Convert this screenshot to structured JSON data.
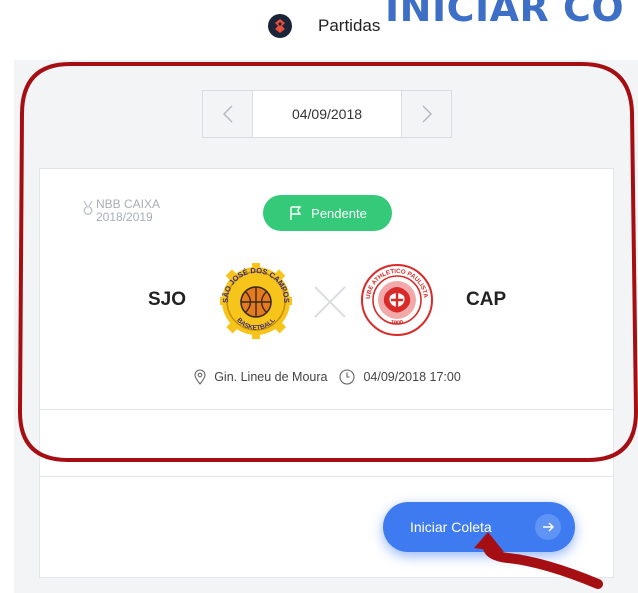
{
  "slide": {
    "title_fragment": "INICIAR CO"
  },
  "header": {
    "logo_icon": "app-logo-icon",
    "title": "Partidas"
  },
  "date_nav": {
    "prev_icon": "chevron-left-icon",
    "value": "04/09/2018",
    "next_icon": "chevron-right-icon"
  },
  "match": {
    "league_icon": "medal-icon",
    "league_line1": "NBB CAIXA",
    "league_line2": "2018/2019",
    "status_icon": "flag-icon",
    "status": "Pendente",
    "home_code": "SJO",
    "home_logo_text": "SÃO JOSÉ DOS CAMPOS",
    "home_logo_subtext": "BASKETBALL",
    "away_code": "CAP",
    "away_logo_text": "CLUBE ATHLETICO PAULISTANO",
    "away_logo_subtext": "1900",
    "venue_icon": "location-pin-icon",
    "venue": "Gin. Lineu de Moura",
    "time_icon": "clock-icon",
    "datetime": "04/09/2018 17:00"
  },
  "actions": {
    "start_label": "Iniciar Coleta",
    "start_icon": "arrow-right-icon"
  },
  "colors": {
    "accent_blue": "#3f7bf0",
    "status_green": "#35c97a",
    "highlight_red": "#a50f14",
    "title_blue": "#3d6fc6"
  }
}
